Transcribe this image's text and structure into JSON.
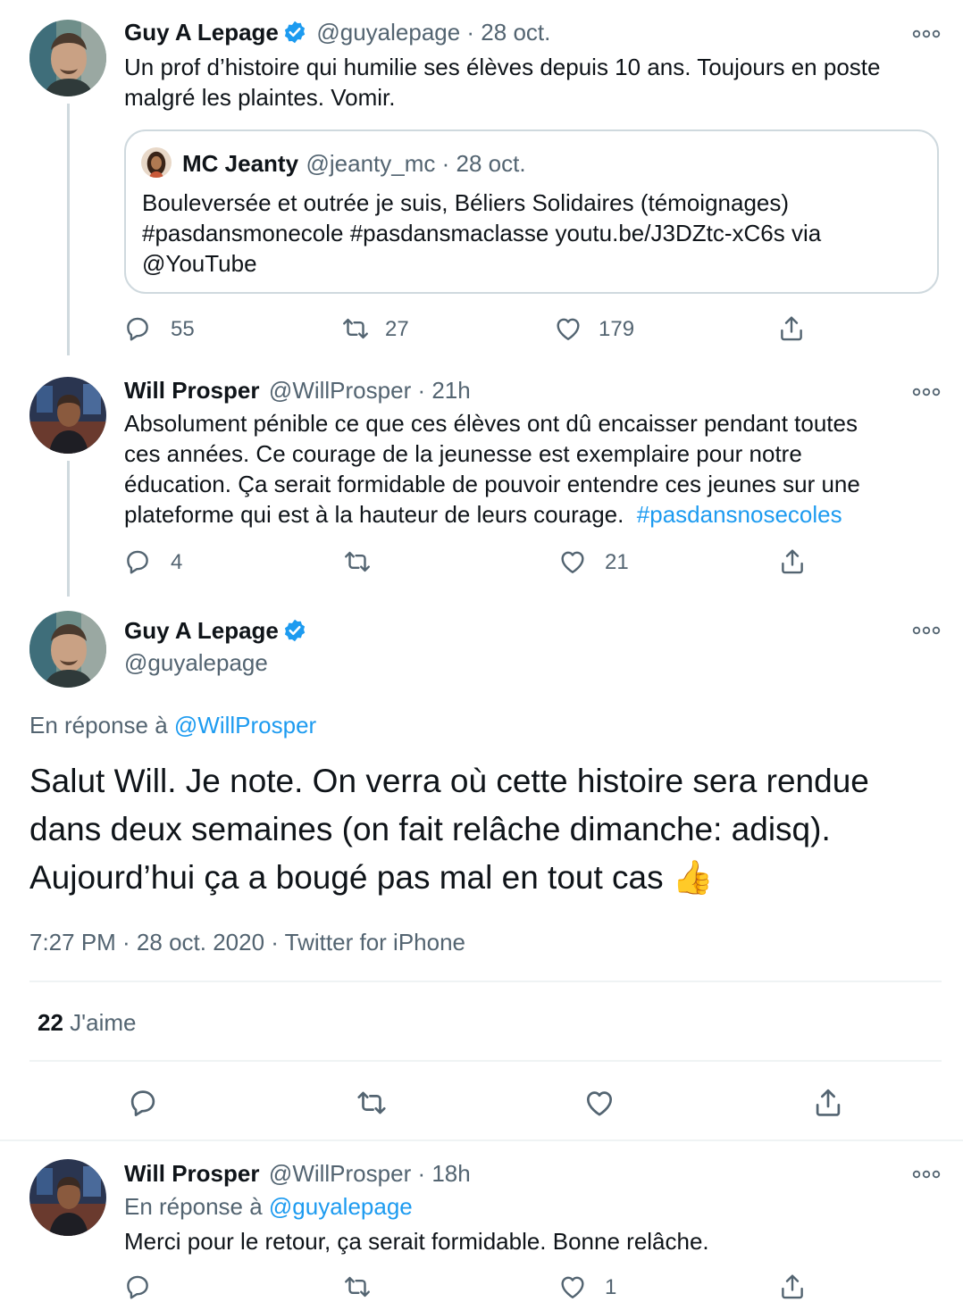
{
  "tweet1": {
    "name": "Guy A Lepage",
    "handle_time": "@guyalepage · 28 oct.",
    "lines": [
      "Un prof d’histoire qui humilie ses élèves depuis 10 ans. Toujours en poste",
      "malgré les plaintes. Vomir."
    ],
    "quote": {
      "name": "MC Jeanty",
      "handle_time": "@jeanty_mc · 28 oct.",
      "lines": [
        "Bouleversée et outrée je suis, Béliers Solidaires  (témoignages)",
        "#pasdansmonecole #pasdansmaclasse youtu.be/J3DZtc-xC6s via",
        "@YouTube"
      ]
    },
    "replies": "55",
    "retweets": "27",
    "likes": "179"
  },
  "tweet2": {
    "name": "Will Prosper",
    "handle_time": "@WillProsper · 21h",
    "lines": [
      "Absolument pénible ce que ces élèves ont dû encaisser pendant toutes",
      "ces années. Ce courage de la jeunesse est exemplaire pour notre",
      "éducation.  Ça serait formidable de pouvoir entendre ces jeunes sur une",
      "plateforme qui est à la hauteur de leurs courage.  "
    ],
    "hashtag": "#pasdansnosecoles",
    "replies": "4",
    "likes": "21"
  },
  "main": {
    "name": "Guy A Lepage",
    "handle": "@guyalepage",
    "reply_prefix": "En réponse à ",
    "reply_to": "@WillProsper",
    "lines": [
      "Salut Will. Je note. On verra où cette histoire sera rendue",
      "dans deux semaines (on fait relâche dimanche: adisq).",
      "Aujourd’hui ça a bougé pas mal en tout cas"
    ],
    "emoji": "👍",
    "meta": "7:27 PM · 28 oct. 2020 · Twitter for iPhone",
    "likes_count": "22",
    "likes_label": "J'aime"
  },
  "tweet3": {
    "name": "Will Prosper",
    "handle_time": "@WillProsper · 18h",
    "reply_prefix": "En réponse à ",
    "reply_to": "@guyalepage",
    "text": "Merci pour le retour, ça serait formidable.  Bonne relâche.",
    "likes": "1"
  },
  "colors": {
    "accent": "#1d9bf0",
    "secondary_text": "#536471",
    "primary_text": "#0f1419",
    "border": "#cfd9de"
  },
  "icons": [
    "more-icon",
    "verified-icon",
    "reply-icon",
    "retweet-icon",
    "like-icon",
    "share-icon"
  ]
}
